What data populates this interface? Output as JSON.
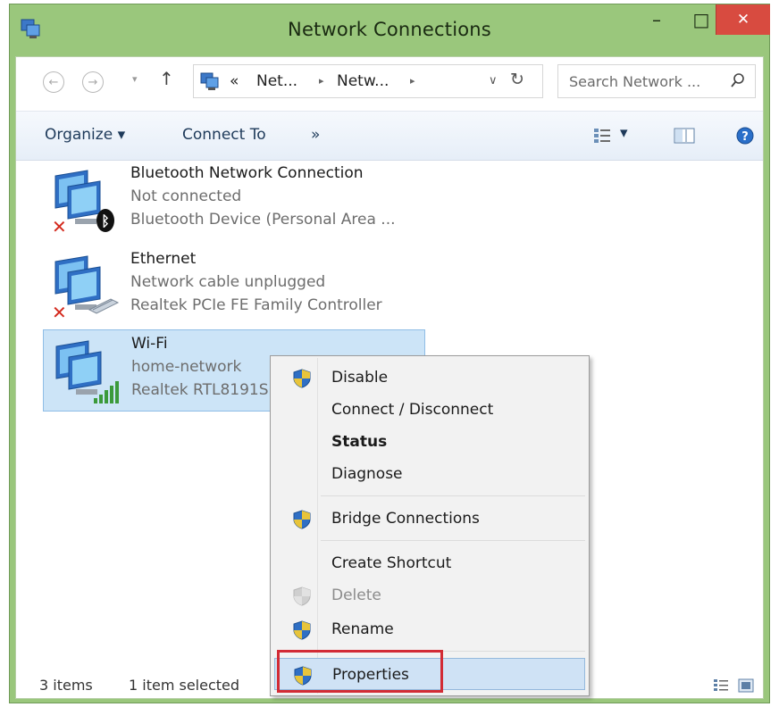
{
  "window": {
    "title": "Network Connections",
    "minimize_glyph": "–",
    "maximize_glyph": "□",
    "close_glyph": "✕"
  },
  "address_bar": {
    "back_glyph": "←",
    "forward_glyph": "→",
    "history_drop_glyph": "▾",
    "up_glyph": "↑",
    "overflow": "«",
    "crumbs": [
      "Net...",
      "Netw..."
    ],
    "crumb_sep": "▸",
    "dropdown_glyph": "∨",
    "refresh_glyph": "↻",
    "search_placeholder": "Search Network ..."
  },
  "commands": {
    "organize": "Organize ▾",
    "connect_to": "Connect To",
    "more": "»",
    "view_drop": "▾"
  },
  "items": [
    {
      "name": "Bluetooth Network Connection",
      "status": "Not connected",
      "device": "Bluetooth Device (Personal Area ...",
      "icon": "bluetooth-network-icon",
      "state": "disconnected"
    },
    {
      "name": "Ethernet",
      "status": "Network cable unplugged",
      "device": "Realtek PCIe FE Family Controller",
      "icon": "ethernet-network-icon",
      "state": "disconnected"
    },
    {
      "name": "Wi-Fi",
      "status": "home-network",
      "device": "Realtek RTL8191SE",
      "icon": "wifi-network-icon",
      "state": "selected"
    }
  ],
  "context_menu": {
    "items": [
      {
        "label": "Disable",
        "shield": true
      },
      {
        "label": "Connect / Disconnect",
        "shield": false
      },
      {
        "label": "Status",
        "shield": false,
        "bold": true
      },
      {
        "label": "Diagnose",
        "shield": false
      },
      {
        "label": "Bridge Connections",
        "shield": true
      },
      {
        "label": "Create Shortcut",
        "shield": false
      },
      {
        "label": "Delete",
        "shield": true,
        "disabled": true
      },
      {
        "label": "Rename",
        "shield": true
      },
      {
        "label": "Properties",
        "shield": true,
        "hover": true
      }
    ]
  },
  "status_bar": {
    "item_count": "3 items",
    "selection": "1 item selected"
  },
  "colors": {
    "titlebar": "#9ac77c",
    "close_button": "#d84b40",
    "selection": "#cce4f7",
    "highlight_box": "#d22b35"
  }
}
